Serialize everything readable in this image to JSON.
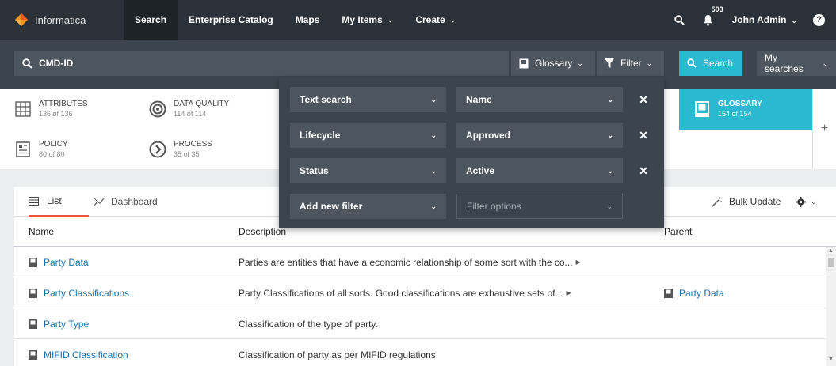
{
  "brand": {
    "name": "Informatica"
  },
  "nav": {
    "items": [
      {
        "label": "Search",
        "active": true,
        "dropdown": false
      },
      {
        "label": "Enterprise Catalog",
        "active": false,
        "dropdown": false
      },
      {
        "label": "Maps",
        "active": false,
        "dropdown": false
      },
      {
        "label": "My Items",
        "active": false,
        "dropdown": true
      },
      {
        "label": "Create",
        "active": false,
        "dropdown": true
      }
    ],
    "notification_count": "503",
    "user": "John Admin",
    "help": "?"
  },
  "search": {
    "query": "CMD-ID",
    "glossary_label": "Glossary",
    "filter_label": "Filter",
    "search_button": "Search",
    "my_searches": "My searches"
  },
  "facets": [
    {
      "title": "ATTRIBUTES",
      "count": "136 of 136",
      "icon": "grid-icon"
    },
    {
      "title": "DATA QUALITY",
      "count": "114 of 114",
      "icon": "target-icon"
    },
    {
      "title": "GLOSSARY",
      "count": "154 of 154",
      "icon": "book-icon",
      "selected": true
    },
    {
      "title": "POLICY",
      "count": "80 of 80",
      "icon": "policy-icon"
    },
    {
      "title": "PROCESS",
      "count": "35 of 35",
      "icon": "process-icon"
    }
  ],
  "filters": {
    "rows": [
      {
        "field": "Text search",
        "value": "Name"
      },
      {
        "field": "Lifecycle",
        "value": "Approved"
      },
      {
        "field": "Status",
        "value": "Active"
      }
    ],
    "add_label": "Add new filter",
    "options_placeholder": "Filter options"
  },
  "tabs": {
    "list": "List",
    "dashboard": "Dashboard"
  },
  "toolbar": {
    "bulk_update": "Bulk Update"
  },
  "table": {
    "columns": [
      "Name",
      "Description",
      "Parent"
    ],
    "rows": [
      {
        "name": "Party Data",
        "description": "Parties are entities that have a economic relationship of some sort with the co...",
        "parent": ""
      },
      {
        "name": "Party Classifications",
        "description": "Party Classifications of all sorts. Good classifications are exhaustive sets of...",
        "parent": "Party Data"
      },
      {
        "name": "Party Type",
        "description": "Classification of the type of party.",
        "parent": ""
      },
      {
        "name": "MIFID Classification",
        "description": "Classification of party as per MIFID regulations.",
        "parent": ""
      }
    ]
  },
  "colors": {
    "nav_bg": "#2b3138",
    "band_bg": "#3c454e",
    "accent": "#2bb8d1",
    "tab_underline": "#e8553a",
    "link": "#1a6fa8"
  }
}
